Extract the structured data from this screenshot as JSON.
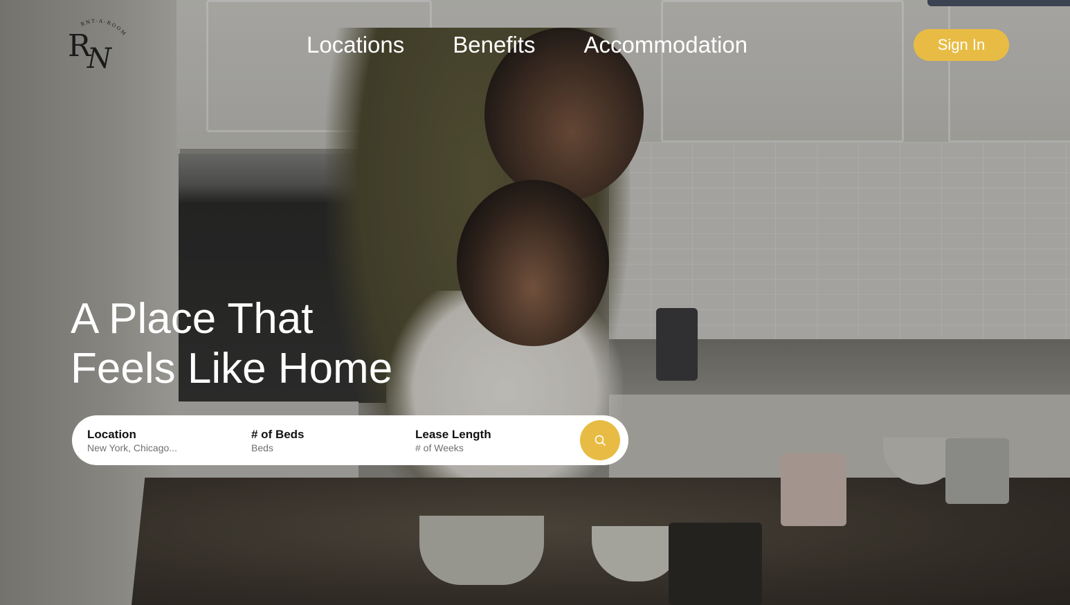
{
  "brand": {
    "logo_monogram": "RN",
    "logo_tagline": "RNT-A-ROOM"
  },
  "nav": {
    "items": [
      "Locations",
      "Benefits",
      "Accommodation"
    ],
    "sign_in_label": "Sign In"
  },
  "hero": {
    "headline_line1": "A Place That",
    "headline_line2": "Feels Like Home"
  },
  "search": {
    "fields": [
      {
        "label": "Location",
        "placeholder": "New York, Chicago..."
      },
      {
        "label": "# of Beds",
        "placeholder": "Beds"
      },
      {
        "label": "Lease Length",
        "placeholder": "# of Weeks"
      }
    ],
    "button_icon": "search-icon"
  },
  "colors": {
    "accent": "#e8bc44",
    "text_light": "#ffffff",
    "search_bg": "#ffffff"
  }
}
